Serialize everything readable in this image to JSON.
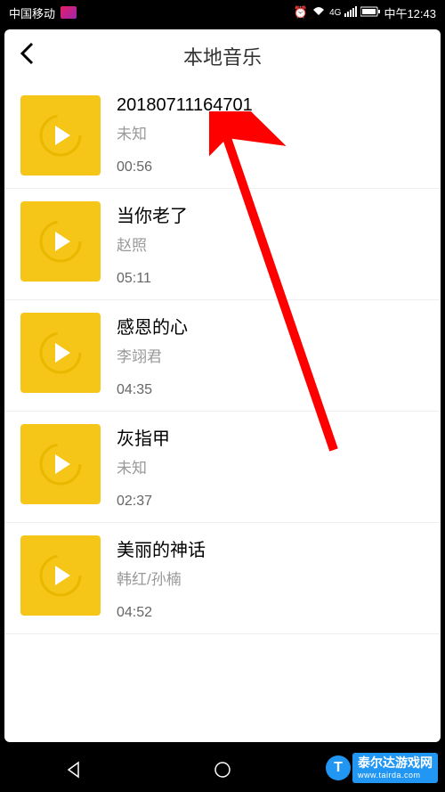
{
  "statusBar": {
    "carrier": "中国移动",
    "time": "中午12:43",
    "signal": "4G"
  },
  "header": {
    "title": "本地音乐"
  },
  "songs": [
    {
      "title": "20180711164701",
      "artist": "未知",
      "duration": "00:56"
    },
    {
      "title": "当你老了",
      "artist": "赵照",
      "duration": "05:11"
    },
    {
      "title": "感恩的心",
      "artist": "李翊君",
      "duration": "04:35"
    },
    {
      "title": "灰指甲",
      "artist": "未知",
      "duration": "02:37"
    },
    {
      "title": "美丽的神话",
      "artist": "韩红/孙楠",
      "duration": "04:52"
    }
  ],
  "watermark": {
    "text": "泰尔达游戏网",
    "url": "www.tairda.com"
  }
}
